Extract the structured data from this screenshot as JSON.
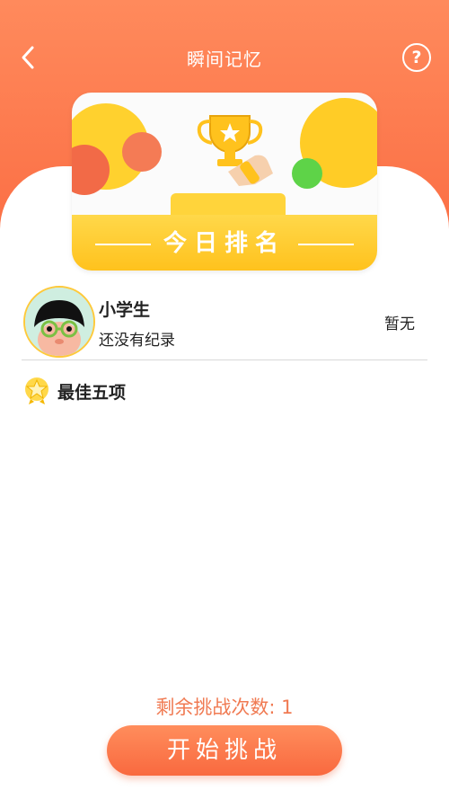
{
  "header": {
    "title": "瞬间记忆",
    "help_label": "?"
  },
  "banner": {
    "title": "今日排名"
  },
  "profile": {
    "name": "小学生",
    "subtitle": "还没有纪录",
    "rank": "暂无"
  },
  "best": {
    "label": "最佳五项"
  },
  "footer": {
    "remaining": "剩余挑战次数: 1",
    "start_label": "开始挑战"
  },
  "colors": {
    "accent": "#fb6f45",
    "banner_yellow": "#ffc21d",
    "remaining_text": "#f07a52"
  }
}
